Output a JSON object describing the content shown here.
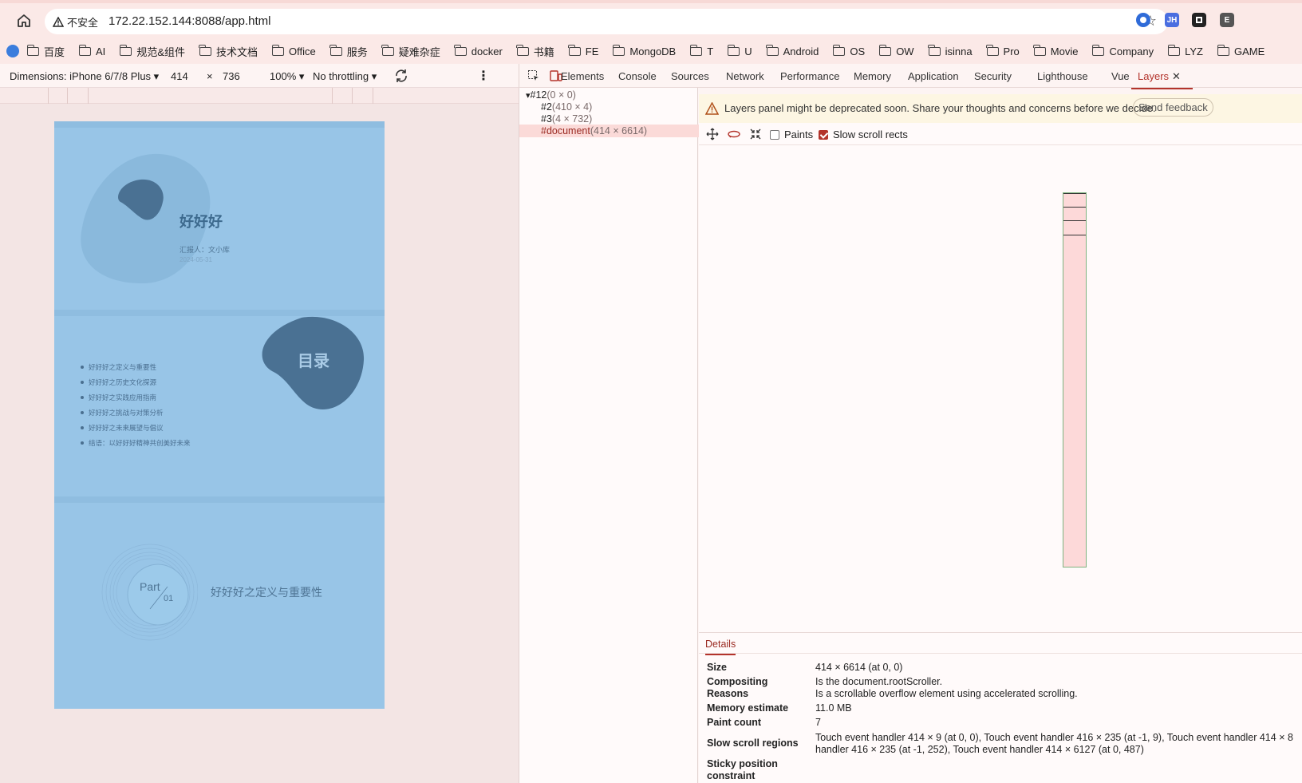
{
  "browser": {
    "insecure_label": "不安全",
    "url": "172.22.152.144:8088/app.html",
    "extensions": [
      "JH",
      "E"
    ]
  },
  "bookmarks": [
    "百度",
    "AI",
    "规范&组件",
    "技术文档",
    "Office",
    "服务",
    "疑难杂症",
    "docker",
    "书籍",
    "FE",
    "MongoDB",
    "T",
    "U",
    "Android",
    "OS",
    "OW",
    "isinna",
    "Pro",
    "Movie",
    "Company",
    "LYZ",
    "GAME"
  ],
  "device_toolbar": {
    "dimensions_label": "Dimensions: iPhone 6/7/8 Plus",
    "width": "414",
    "times": "×",
    "height": "736",
    "zoom": "100%",
    "throttling": "No throttling"
  },
  "slides": {
    "title": {
      "heading": "好好好",
      "reporter": "汇报人：文小库",
      "date": "2024-05-31"
    },
    "toc": {
      "heading": "目录",
      "items": [
        "好好好之定义与重要性",
        "好好好之历史文化探源",
        "好好好之实践应用指南",
        "好好好之挑战与对策分析",
        "好好好之未来展望与倡议",
        "结语：以好好好精神共创美好未来"
      ]
    },
    "part": {
      "word": "Part",
      "number": "01",
      "title": "好好好之定义与重要性"
    }
  },
  "devtools": {
    "tabs": [
      "Elements",
      "Console",
      "Sources",
      "Network",
      "Performance",
      "Memory",
      "Application",
      "Security",
      "Lighthouse",
      "Vue",
      "Layers"
    ],
    "active_tab": "Layers",
    "tree": [
      {
        "id": "#12",
        "size": "(0 × 0)"
      },
      {
        "id": "#2",
        "size": "(410 × 4)"
      },
      {
        "id": "#3",
        "size": "(4 × 732)"
      },
      {
        "id": "#document",
        "size": "(414 × 6614)"
      }
    ],
    "banner_text": "Layers panel might be deprecated soon. Share your thoughts and concerns before we decide.",
    "send_feedback": "Send feedback",
    "paints_label": "Paints",
    "slow_scroll_label": "Slow scroll rects",
    "details_tab": "Details",
    "details": {
      "size_label": "Size",
      "size_value": "414 × 6614 (at 0, 0)",
      "compositing_label": "Compositing",
      "compositing_label2": "Reasons",
      "compositing_value1": "Is the document.rootScroller.",
      "compositing_value2": "Is a scrollable overflow element using accelerated scrolling.",
      "memory_label": "Memory estimate",
      "memory_value": "11.0 MB",
      "paint_label": "Paint count",
      "paint_value": "7",
      "slow_label": "Slow scroll regions",
      "slow_value1": "Touch event handler 414 × 9 (at 0, 0), Touch event handler 416 × 235 (at -1, 9), Touch event handler 414 × 8",
      "slow_value2": "handler 416 × 235 (at -1, 252), Touch event handler 414 × 6127 (at 0, 487)",
      "sticky_label": "Sticky position",
      "sticky_label2": "constraint"
    }
  },
  "colors": {
    "accent": "#b3332b",
    "slide_bg": "#98c5e7",
    "blob_dark": "#4a7193",
    "text_dark": "#3d6a8e"
  }
}
